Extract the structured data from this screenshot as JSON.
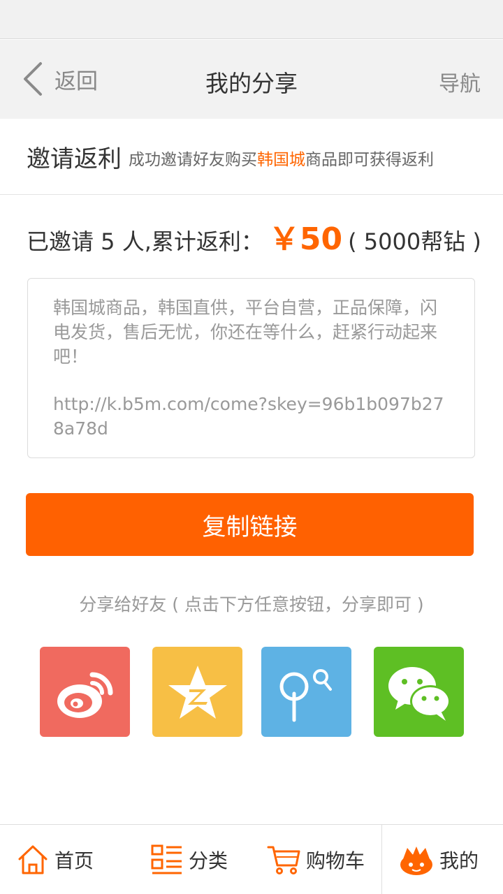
{
  "nav": {
    "back_label": "返回",
    "title": "我的分享",
    "right_label": "导航"
  },
  "invite": {
    "title": "邀请返利",
    "desc_prefix": "成功邀请好友购买",
    "desc_highlight": "韩国城",
    "desc_suffix": "商品即可获得返利"
  },
  "summary": {
    "text": "已邀请 5 人,累计返利：",
    "amount": "￥50",
    "detail": "( 5000帮钻 )"
  },
  "share_box": {
    "text": "韩国城商品，韩国直供，平台自营，正品保障，闪电发货，售后无忧，你还在等什么，赶紧行动起来吧！",
    "link": "http://k.b5m.com/come?skey=96b1b097b278a78d"
  },
  "copy_button_label": "复制链接",
  "share_hint": "分享给好友 ( 点击下方任意按钮，分享即可 )",
  "share_targets": [
    "weibo-icon",
    "qzone-icon",
    "pengyou-icon",
    "wechat-icon"
  ],
  "tabbar": {
    "items": [
      {
        "label": "首页",
        "icon": "home-icon"
      },
      {
        "label": "分类",
        "icon": "category-icon"
      },
      {
        "label": "购物车",
        "icon": "cart-icon"
      },
      {
        "label": "我的",
        "icon": "mine-icon"
      }
    ]
  },
  "colors": {
    "accent": "#ff6101",
    "text": "#333333",
    "muted": "#999999"
  }
}
